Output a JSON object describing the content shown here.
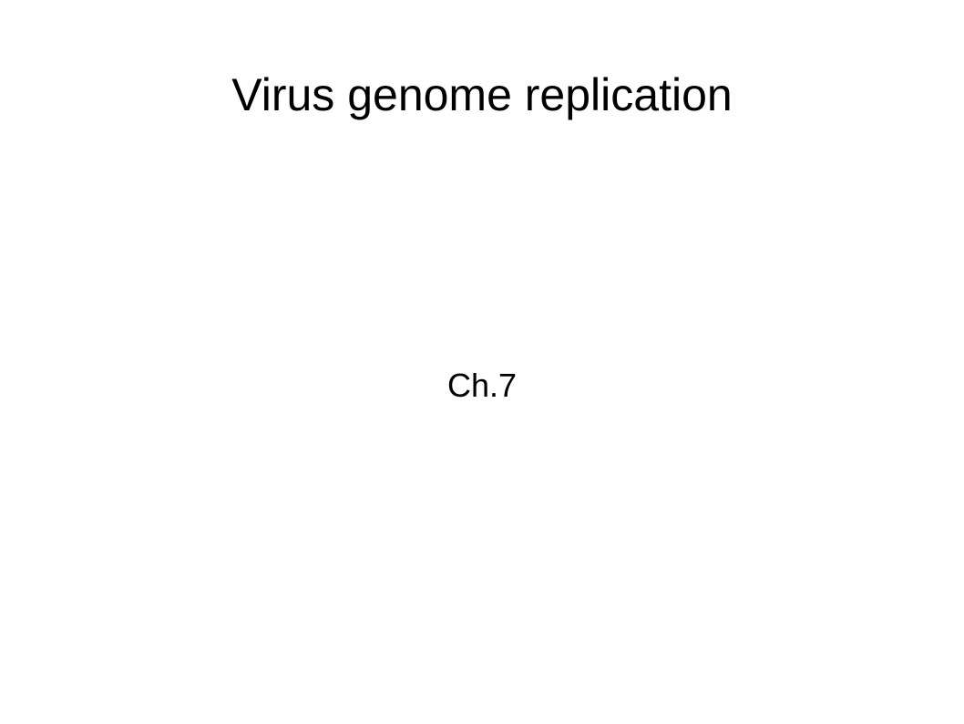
{
  "slide": {
    "title": "Virus genome replication",
    "subtitle": "Ch.7",
    "background_color": "#ffffff",
    "text_color": "#000000"
  }
}
